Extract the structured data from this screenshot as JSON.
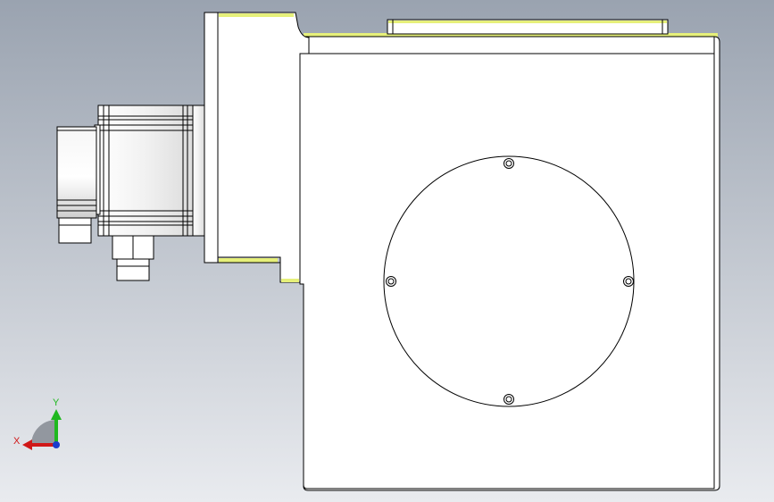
{
  "viewport": {
    "background_top": "#9aa3b0",
    "background_bottom": "#e9ebef"
  },
  "model": {
    "edge_color": "#000000",
    "face_color": "#ffffff",
    "highlight_color": "#e6f07a"
  },
  "triad": {
    "x_label": "X",
    "y_label": "Y",
    "x_color": "#d01818",
    "y_color": "#1fb81f",
    "z_color": "#1a3ccc"
  }
}
